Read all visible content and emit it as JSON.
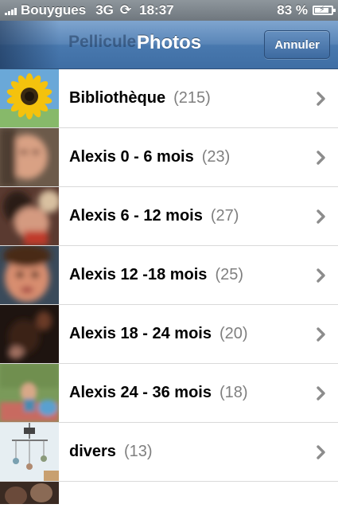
{
  "status_bar": {
    "carrier": "Bouygues",
    "network": "3G",
    "time": "18:37",
    "battery": "83 %",
    "battery_level": 0.83
  },
  "nav_bar": {
    "back_label": "Pellicule",
    "title": "Photos",
    "cancel_label": "Annuler"
  },
  "albums": [
    {
      "name": "Bibliothèque",
      "count": "(215)",
      "thumb": "sunflower"
    },
    {
      "name": "Alexis 0 - 6 mois",
      "count": "(23)",
      "thumb": "baby1"
    },
    {
      "name": "Alexis 6 - 12 mois",
      "count": "(27)",
      "thumb": "baby2"
    },
    {
      "name": "Alexis 12 -18 mois",
      "count": "(25)",
      "thumb": "baby3"
    },
    {
      "name": "Alexis 18 - 24 mois",
      "count": "(20)",
      "thumb": "dark"
    },
    {
      "name": "Alexis 24 - 36 mois",
      "count": "(18)",
      "thumb": "outdoor"
    },
    {
      "name": "divers",
      "count": "(13)",
      "thumb": "mobile"
    }
  ],
  "colors": {
    "nav_top": "#7fa5cf",
    "nav_bottom": "#3f6ea4",
    "count_gray": "#7f7f7f",
    "chevron": "#8c8c8c"
  },
  "icons": {
    "row_chevron": "chevron-right-icon",
    "sync": "sync-icon",
    "battery": "battery-charging-icon",
    "signal": "signal-bars-icon"
  }
}
